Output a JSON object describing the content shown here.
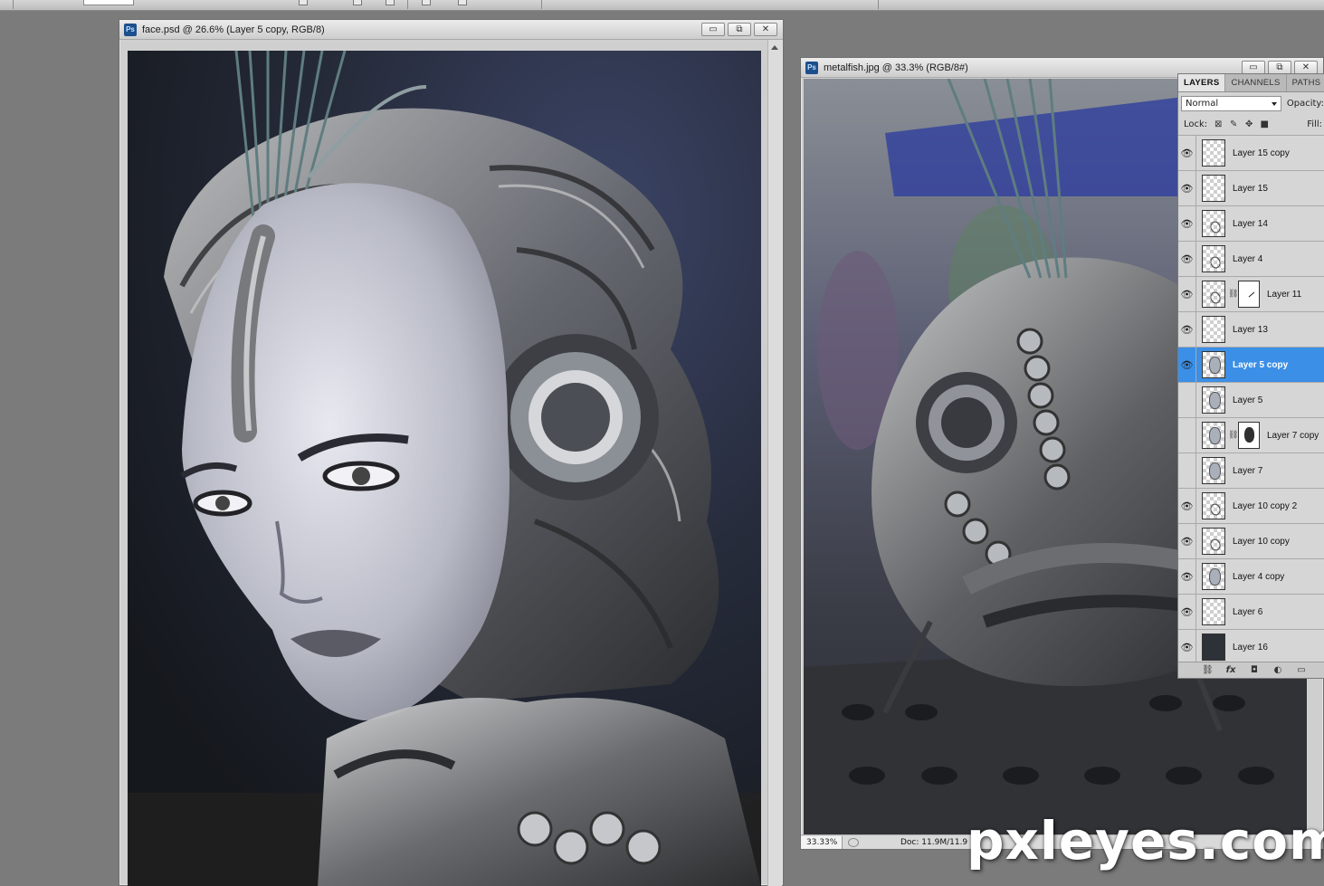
{
  "face_window": {
    "title": "face.psd @ 26.6% (Layer 5 copy, RGB/8)",
    "buttons": [
      "▭",
      "⧉",
      "✕"
    ]
  },
  "metal_window": {
    "title": "metalfish.jpg @ 33.3% (RGB/8#)",
    "buttons": [
      "▭",
      "⧉",
      "✕"
    ],
    "zoom": "33.33%",
    "doc_info": "Doc: 11.9M/11.9"
  },
  "layers_panel": {
    "tabs": [
      "LAYERS",
      "CHANNELS",
      "PATHS"
    ],
    "active_tab": "LAYERS",
    "blend_mode": "Normal",
    "opacity_label": "Opacity:",
    "lock_label": "Lock:",
    "fill_label": "Fill:",
    "layers": [
      {
        "name": "Layer 15 copy",
        "visible": true
      },
      {
        "name": "Layer 15",
        "visible": true
      },
      {
        "name": "Layer 14",
        "visible": true
      },
      {
        "name": "Layer 4",
        "visible": true
      },
      {
        "name": "Layer 11",
        "visible": true,
        "has_mask": true
      },
      {
        "name": "Layer 13",
        "visible": true
      },
      {
        "name": "Layer 5 copy",
        "visible": true,
        "selected": true
      },
      {
        "name": "Layer 5",
        "visible": false
      },
      {
        "name": "Layer 7 copy",
        "visible": false,
        "has_mask": true
      },
      {
        "name": "Layer 7",
        "visible": false
      },
      {
        "name": "Layer 10 copy 2",
        "visible": true
      },
      {
        "name": "Layer 10 copy",
        "visible": true
      },
      {
        "name": "Layer 4 copy",
        "visible": true
      },
      {
        "name": "Layer 6",
        "visible": true
      },
      {
        "name": "Layer 16",
        "visible": true
      }
    ],
    "footer_icons": [
      "link-icon",
      "fx-icon",
      "mask-icon",
      "adjustment-icon",
      "folder-icon"
    ]
  },
  "watermark": "pxleyes.com",
  "colors": {
    "selection": "#3c8fe6",
    "workspace": "#7b7b7b"
  }
}
